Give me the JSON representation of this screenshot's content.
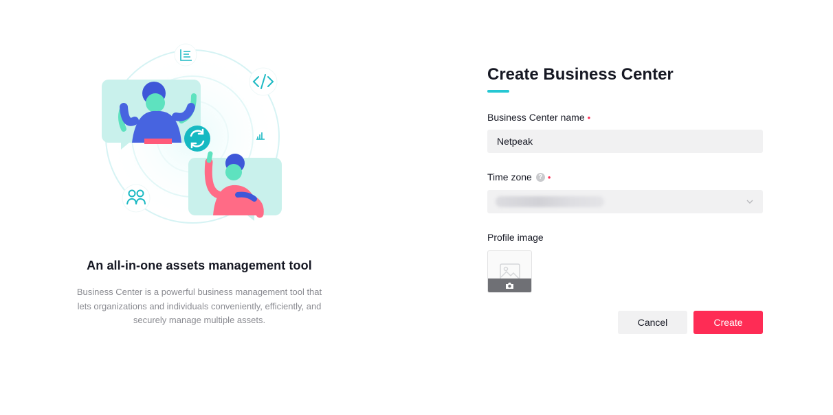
{
  "intro": {
    "tagline": "An all-in-one assets management tool",
    "description": "Business Center is a powerful business management tool that lets organizations and individuals conveniently, efficiently, and securely manage multiple assets."
  },
  "form": {
    "title": "Create Business Center",
    "name_field": {
      "label": "Business Center name",
      "required_mark": "•",
      "value": "Netpeak",
      "placeholder": ""
    },
    "timezone_field": {
      "label": "Time zone",
      "help_icon": "?",
      "required_mark": "•",
      "value_blurred": true
    },
    "profile_image": {
      "label": "Profile image"
    },
    "buttons": {
      "cancel": "Cancel",
      "create": "Create"
    }
  },
  "colors": {
    "accent": "#25c7d3",
    "primary": "#fe2c55",
    "field_bg": "#f1f1f2",
    "text": "#161823",
    "muted_text": "#8a8b91"
  },
  "icons": [
    "list-icon",
    "code-icon",
    "refresh-icon",
    "bar-chart-icon",
    "users-icon",
    "image-placeholder-icon",
    "camera-icon",
    "chevron-down-icon",
    "help-icon"
  ]
}
